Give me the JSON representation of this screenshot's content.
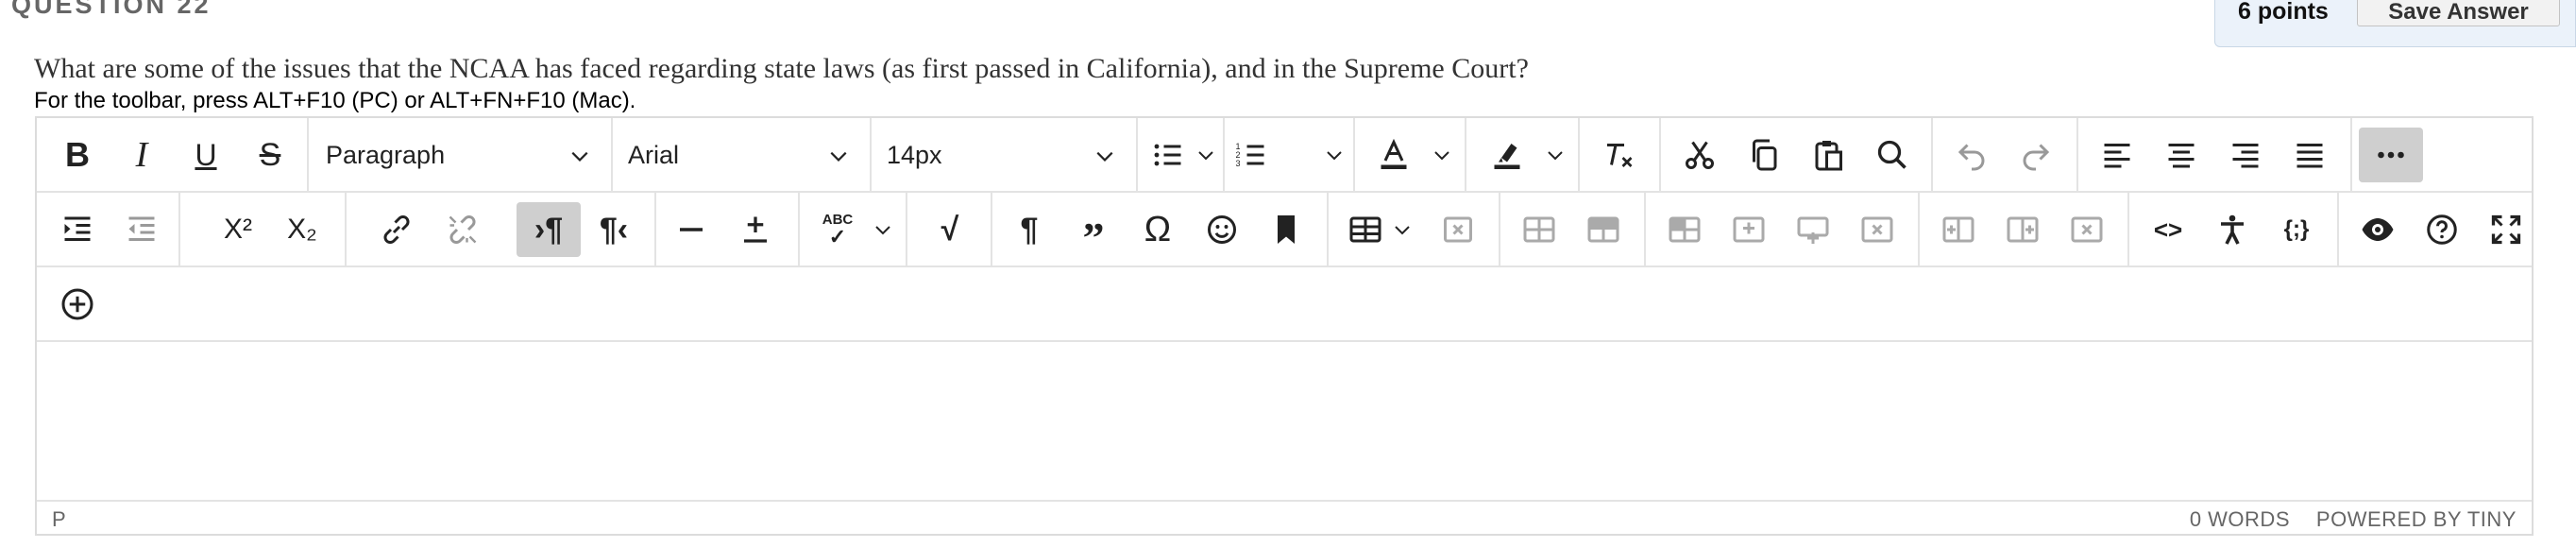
{
  "question": {
    "number_label": "QUESTION 22",
    "points": "6 points",
    "save_label": "Save Answer",
    "text": "What are some of the issues that the NCAA has faced regarding state laws (as first passed in California), and in the Supreme Court?",
    "toolbar_hint": "For the toolbar, press ALT+F10 (PC) or ALT+FN+F10 (Mac)."
  },
  "toolbar": {
    "block_format": "Paragraph",
    "font_family": "Arial",
    "font_size": "14px",
    "superscript_glyph": "X²",
    "subscript_glyph": "X₂",
    "spellcheck_glyph": "ABC",
    "source_code_glyph": "<>",
    "template_glyph": "{;}"
  },
  "editor": {
    "path": "P",
    "word_count": "0 WORDS",
    "powered_by": "POWERED BY TINY"
  }
}
